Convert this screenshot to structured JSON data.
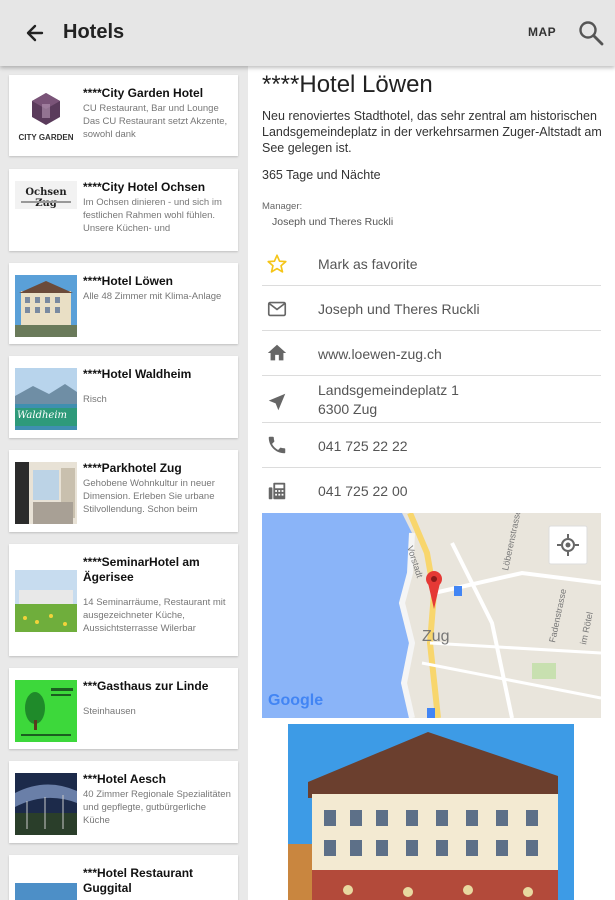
{
  "appbar": {
    "title": "Hotels",
    "map_label": "MAP"
  },
  "hotels": [
    {
      "name": "****City Garden Hotel",
      "desc": "CU Restaurant, Bar und Lounge Das CU Restaurant setzt Akzente, sowohl dank",
      "logo_text": "CITY GARDEN"
    },
    {
      "name": "****City Hotel Ochsen",
      "desc": "Im Ochsen dinieren - und sich im festlichen Rahmen wohl fühlen. Unsere Küchen- und",
      "logo_text": "Ochsen Zug"
    },
    {
      "name": "****Hotel Löwen",
      "desc": "Alle 48 Zimmer mit Klima-Anlage"
    },
    {
      "name": "****Hotel Waldheim",
      "desc": "Risch",
      "logo_text": "Waldheim"
    },
    {
      "name": "****Parkhotel Zug",
      "desc": "Gehobene Wohnkultur in neuer Dimension. Erleben Sie urbane Stilvollendung.  Schon beim"
    },
    {
      "name": "****SeminarHotel am Ägerisee",
      "desc": "14 Seminarräume, Restaurant mit ausgezeichneter Küche, Aussichtsterrasse Wilerbar"
    },
    {
      "name": "***Gasthaus zur Linde",
      "desc": "Steinhausen"
    },
    {
      "name": "***Hotel Aesch",
      "desc": "40 Zimmer Regionale Spezialitäten und gepflegte, gutbürgerliche Küche"
    },
    {
      "name": "***Hotel Restaurant Guggital",
      "desc": ""
    }
  ],
  "detail": {
    "title": "****Hotel Löwen",
    "intro": "Neu renoviertes Stadthotel, das sehr zentral am historischen Landsgemeindeplatz in der verkehrsarmen Zuger-Altstadt am See gelegen ist.",
    "opening": "365 Tage und Nächte",
    "manager_label": "Manager:",
    "manager_value": "Joseph und Theres Ruckli",
    "favorite": "Mark as favorite",
    "contact": "Joseph und Theres Ruckli",
    "website": "www.loewen-zug.ch",
    "address_line1": "Landsgemeindeplatz 1",
    "address_line2": "6300 Zug",
    "phone": "041 725 22 22",
    "fax": "041 725 22 00"
  },
  "map": {
    "city_label": "Zug",
    "street_1": "Vorstadt",
    "street_2": "Löberenstrasse",
    "street_3": "Fadenstrasse",
    "street_4": "im Rötel",
    "attribution": "Google"
  },
  "colors": {
    "star": "#f5c518",
    "marker": "#e53935",
    "lake": "#8ab4f8",
    "road": "#f8d66d"
  }
}
